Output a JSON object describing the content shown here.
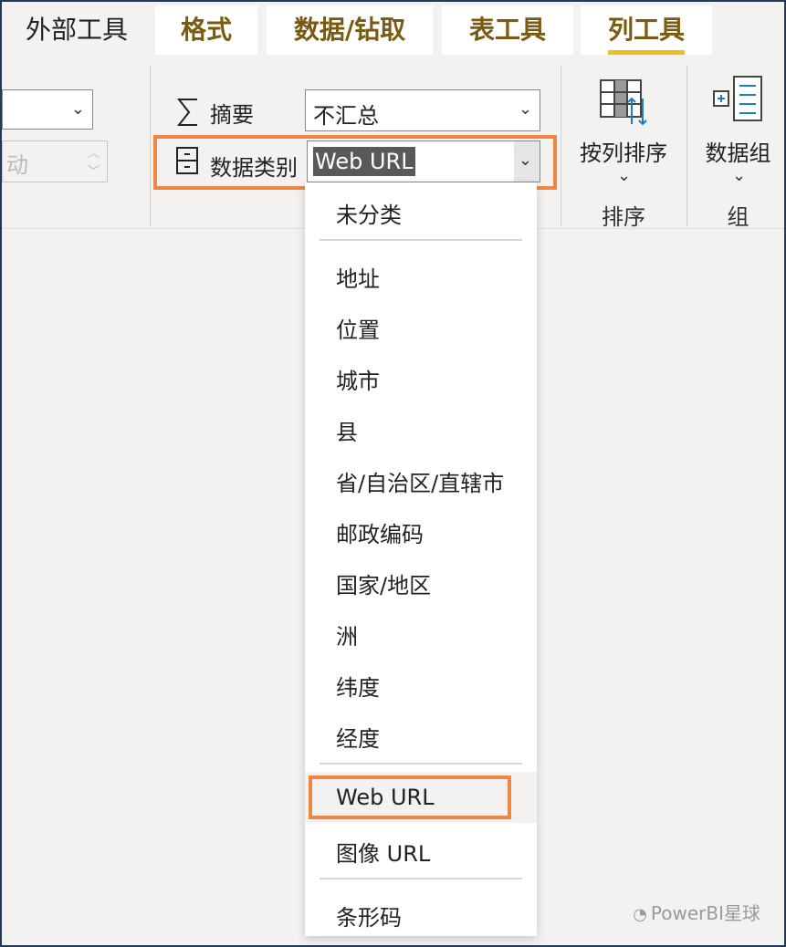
{
  "tabs": [
    {
      "label": "外部工具"
    },
    {
      "label": "格式"
    },
    {
      "label": "数据/钻取"
    },
    {
      "label": "表工具"
    },
    {
      "label": "列工具"
    }
  ],
  "ribbon": {
    "disabled_text": "动",
    "summary_label": "摘要",
    "summary_value": "不汇总",
    "category_label": "数据类别",
    "category_value": "Web URL",
    "sort_button": "按列排序",
    "sort_group": "排序",
    "group_button": "数据组",
    "group_group": "组"
  },
  "dropdown": {
    "items": [
      "未分类",
      "地址",
      "位置",
      "城市",
      "县",
      "省/自治区/直辖市",
      "邮政编码",
      "国家/地区",
      "洲",
      "纬度",
      "经度",
      "Web URL",
      "图像 URL",
      "条形码"
    ],
    "selected": "Web URL"
  },
  "watermark": "PowerBI星球",
  "colors": {
    "accent_orange": "#ef8744",
    "tab_underline": "#e8c11a",
    "tab_text": "#7a5a10"
  }
}
